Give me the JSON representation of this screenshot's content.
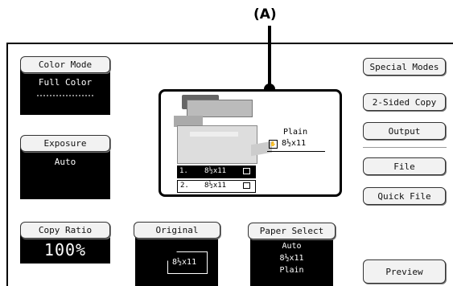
{
  "callout": {
    "label": "(A)"
  },
  "color_mode": {
    "label": "Color Mode",
    "value": "Full Color"
  },
  "exposure": {
    "label": "Exposure",
    "value": "Auto"
  },
  "copy_ratio": {
    "label": "Copy Ratio",
    "value": "100%"
  },
  "original": {
    "label": "Original",
    "size": "8½x11"
  },
  "paper_select": {
    "label": "Paper Select",
    "lines": [
      "Auto",
      "8½x11",
      "Plain"
    ]
  },
  "preview_area": {
    "paper_type": "Plain",
    "bypass_size": "8½x11",
    "trays": [
      {
        "num": "1.",
        "size": "8½x11"
      },
      {
        "num": "2.",
        "size": "8½x11"
      }
    ]
  },
  "right_menu": {
    "special_modes": "Special Modes",
    "two_sided": "2-Sided Copy",
    "output": "Output",
    "file": "File",
    "quick_file": "Quick File",
    "preview": "Preview"
  }
}
